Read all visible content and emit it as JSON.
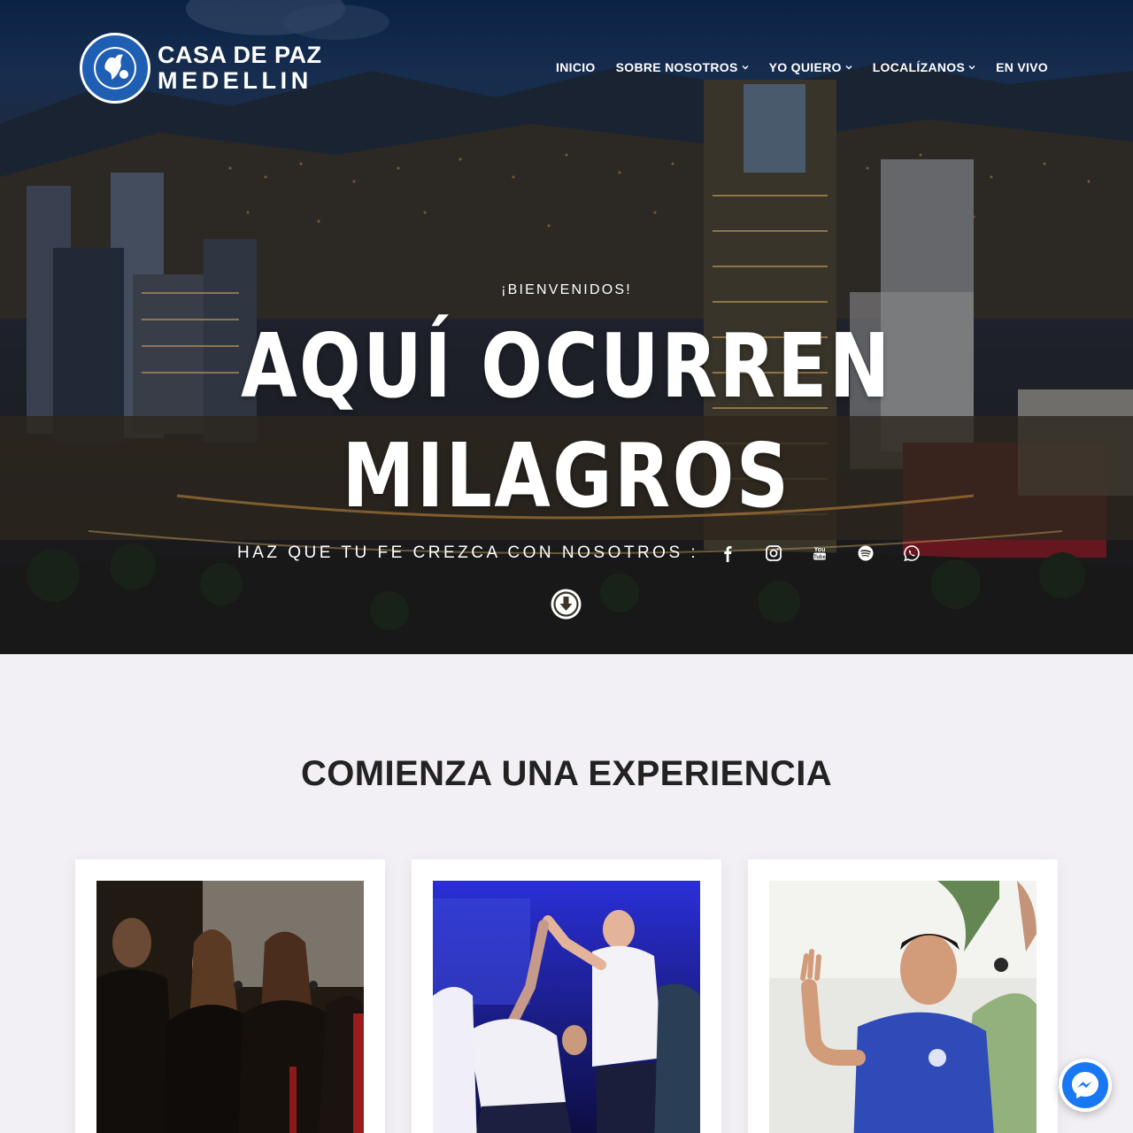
{
  "header": {
    "logo": {
      "line1": "CASA DE PAZ",
      "line2": "MEDELLIN",
      "badge_text_top": "CASA DE PAZ",
      "badge_text_bottom": "MEDELLIN",
      "color": "#1f5fb3"
    },
    "nav": [
      {
        "label": "INICIO",
        "dropdown": false
      },
      {
        "label": "SOBRE NOSOTROS",
        "dropdown": true
      },
      {
        "label": "YO QUIERO",
        "dropdown": true
      },
      {
        "label": "LOCALÍZANOS",
        "dropdown": true
      },
      {
        "label": "EN VIVO",
        "dropdown": false
      }
    ]
  },
  "hero": {
    "welcome": "¡BIENVENIDOS!",
    "headline_line1": "AQUÍ OCURREN",
    "headline_line2": "MILAGROS",
    "tagline": "HAZ QUE TU FE CREZCA CON NOSOTROS :",
    "social_icons": [
      "facebook-icon",
      "instagram-icon",
      "youtube-icon",
      "spotify-icon",
      "whatsapp-icon"
    ],
    "scroll_icon": "arrow-down-circle-icon"
  },
  "section": {
    "title": "COMIENZA UNA EXPERIENCIA",
    "background": "#f3f0f5",
    "cards": [
      {
        "image": "worship-singers-photo"
      },
      {
        "image": "prayer-stage-photo"
      },
      {
        "image": "praying-man-photo"
      }
    ]
  },
  "chat_widget": {
    "icon": "messenger-icon",
    "color": "#1877f2"
  }
}
